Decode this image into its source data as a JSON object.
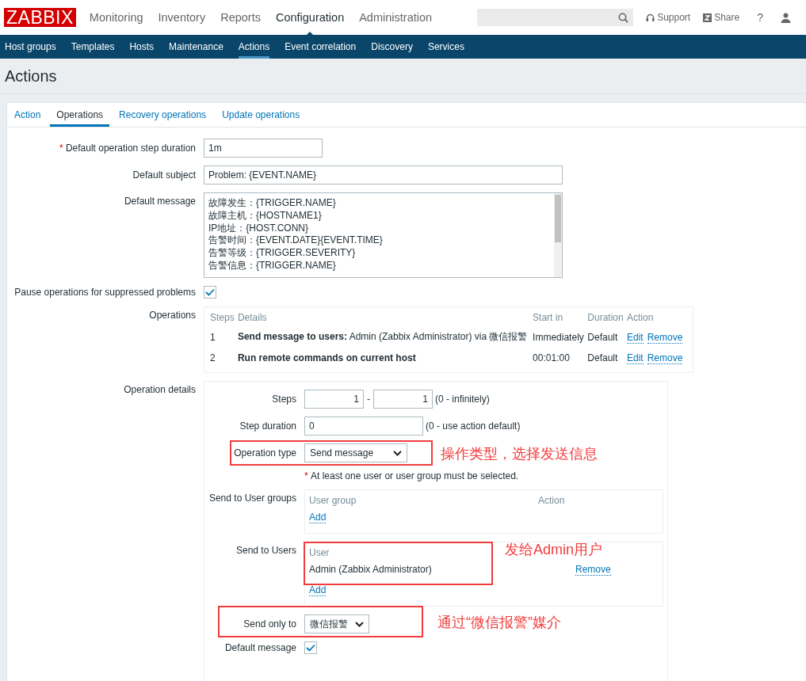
{
  "header": {
    "logo": "ZABBIX",
    "menu": [
      {
        "label": "Monitoring",
        "selected": false
      },
      {
        "label": "Inventory",
        "selected": false
      },
      {
        "label": "Reports",
        "selected": false
      },
      {
        "label": "Configuration",
        "selected": true
      },
      {
        "label": "Administration",
        "selected": false
      }
    ],
    "links": [
      {
        "kind": "support",
        "label": "Support"
      },
      {
        "kind": "share",
        "label": "Share"
      }
    ],
    "help": "?"
  },
  "submenu": [
    {
      "label": "Host groups",
      "selected": false
    },
    {
      "label": "Templates",
      "selected": false
    },
    {
      "label": "Hosts",
      "selected": false
    },
    {
      "label": "Maintenance",
      "selected": false
    },
    {
      "label": "Actions",
      "selected": true
    },
    {
      "label": "Event correlation",
      "selected": false
    },
    {
      "label": "Discovery",
      "selected": false
    },
    {
      "label": "Services",
      "selected": false
    }
  ],
  "page_title": "Actions",
  "tabs": [
    {
      "label": "Action",
      "selected": false
    },
    {
      "label": "Operations",
      "selected": true
    },
    {
      "label": "Recovery operations",
      "selected": false
    },
    {
      "label": "Update operations",
      "selected": false
    }
  ],
  "form": {
    "step_duration": {
      "label": "Default operation step duration",
      "required_mark": "*",
      "value": "1m"
    },
    "subject": {
      "label": "Default subject",
      "value": "Problem: {EVENT.NAME}"
    },
    "message": {
      "label": "Default message",
      "lines": [
        "故障发生：{TRIGGER.NAME}",
        "故障主机：{HOSTNAME1}",
        "IP地址：{HOST.CONN}",
        "告警时间：{EVENT.DATE}{EVENT.TIME}",
        "告警等级：{TRIGGER.SEVERITY}",
        "告警信息：{TRIGGER.NAME}"
      ]
    },
    "pause": {
      "label": "Pause operations for suppressed problems",
      "checked": true
    }
  },
  "operations": {
    "label": "Operations",
    "columns": [
      "Steps",
      "Details",
      "Start in",
      "Duration",
      "Action"
    ],
    "rows": [
      {
        "kind": "message",
        "step": "1",
        "details": "**Send message to users:** Admin (Zabbix Administrator) via 微信报警",
        "start_in": "Immediately",
        "duration": "Default",
        "actions": [
          "Edit",
          "Remove"
        ]
      },
      {
        "kind": "command",
        "step": "2",
        "details": "Run remote commands on current host",
        "start_in": "00:01:00",
        "duration": "Default",
        "actions": [
          "Edit",
          "Remove"
        ]
      }
    ]
  },
  "operation_details": {
    "label": "Operation details",
    "steps": {
      "label": "Steps",
      "from": "1",
      "separator": "-",
      "to": "1",
      "hint": "(0 - infinitely)"
    },
    "step_duration": {
      "label": "Step duration",
      "value": "0",
      "hint": "(0 - use action default)"
    },
    "operation_type": {
      "label": "Operation type",
      "value": "Send message",
      "annotation": "操作类型，选择发送信息"
    },
    "note": {
      "required_mark": "*",
      "text": "At least one user or user group must be selected."
    },
    "user_groups": {
      "label": "Send to User groups",
      "columns": [
        "User group",
        "Action"
      ],
      "add": "Add"
    },
    "users": {
      "label": "Send to Users",
      "columns": [
        "User"
      ],
      "rows": [
        {
          "name": "Admin (Zabbix Administrator)",
          "action": "Remove"
        }
      ],
      "add": "Add",
      "annotation": "发给Admin用户"
    },
    "send_only_to": {
      "label": "Send only to",
      "value": "微信报警",
      "annotation": "通过“微信报警”媒介"
    },
    "default_message": {
      "label": "Default message",
      "checked": true
    }
  }
}
